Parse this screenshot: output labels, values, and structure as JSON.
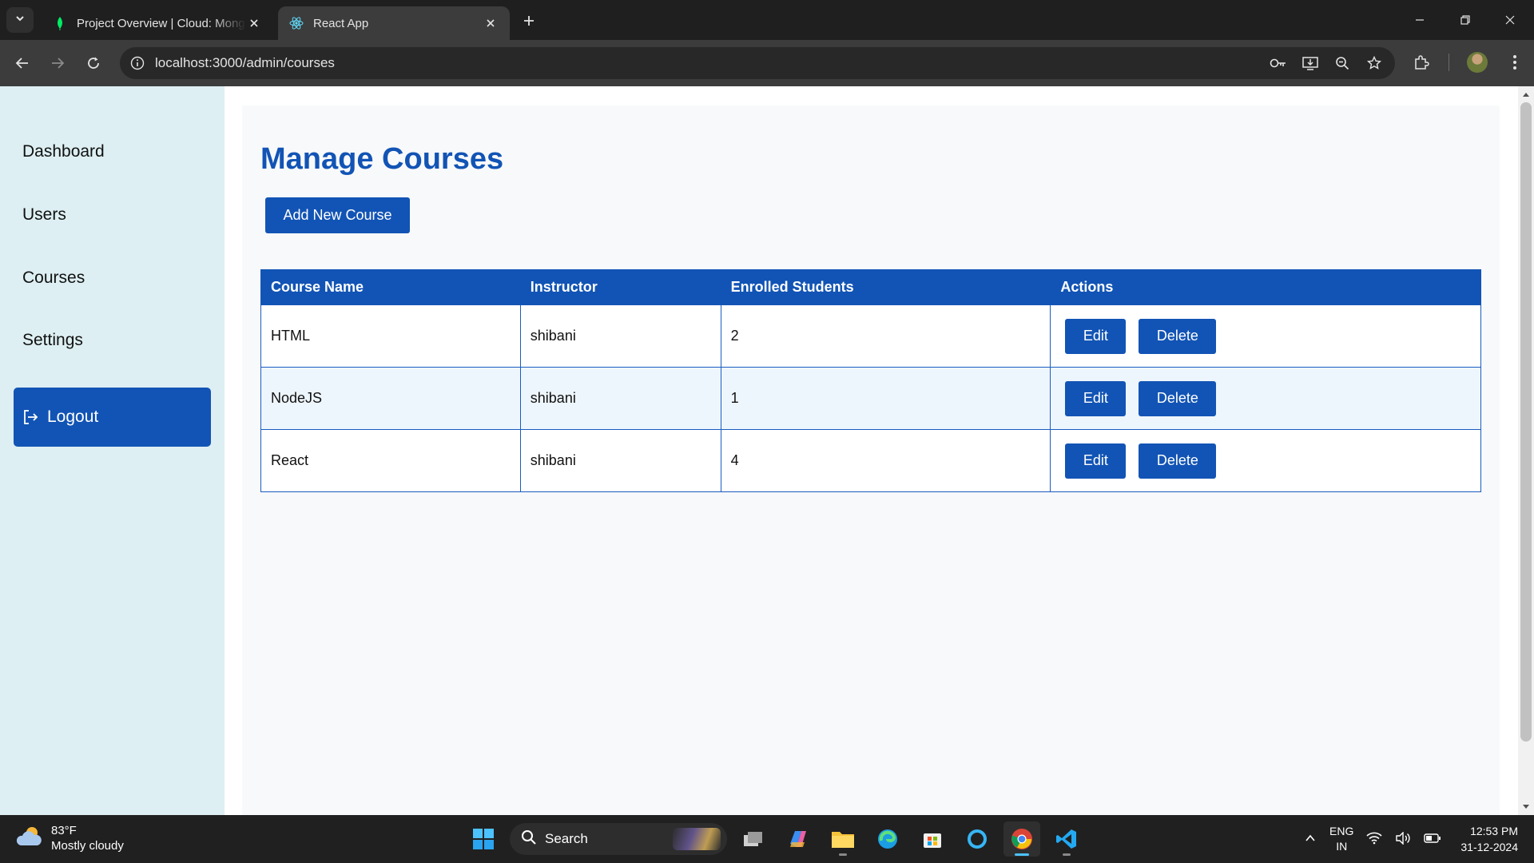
{
  "browser": {
    "tabs": [
      {
        "title": "Project Overview | Cloud: MongoDB",
        "active": false
      },
      {
        "title": "React App",
        "active": true
      }
    ],
    "url": "localhost:3000/admin/courses"
  },
  "sidebar": {
    "items": [
      {
        "label": "Dashboard"
      },
      {
        "label": "Users"
      },
      {
        "label": "Courses"
      },
      {
        "label": "Settings"
      }
    ],
    "logout_label": "Logout"
  },
  "main": {
    "title": "Manage Courses",
    "add_button_label": "Add New Course",
    "table": {
      "columns": [
        "Course Name",
        "Instructor",
        "Enrolled Students",
        "Actions"
      ],
      "rows": [
        {
          "name": "HTML",
          "instructor": "shibani",
          "enrolled": "2"
        },
        {
          "name": "NodeJS",
          "instructor": "shibani",
          "enrolled": "1"
        },
        {
          "name": "React",
          "instructor": "shibani",
          "enrolled": "4"
        }
      ],
      "edit_label": "Edit",
      "delete_label": "Delete"
    }
  },
  "taskbar": {
    "weather_temp": "83°F",
    "weather_desc": "Mostly cloudy",
    "search_label": "Search",
    "lang_line1": "ENG",
    "lang_line2": "IN",
    "time": "12:53 PM",
    "date": "31-12-2024"
  },
  "colors": {
    "accent": "#1254b5",
    "sidebar_bg": "#ddeff2",
    "content_bg": "#f8f9fa"
  }
}
